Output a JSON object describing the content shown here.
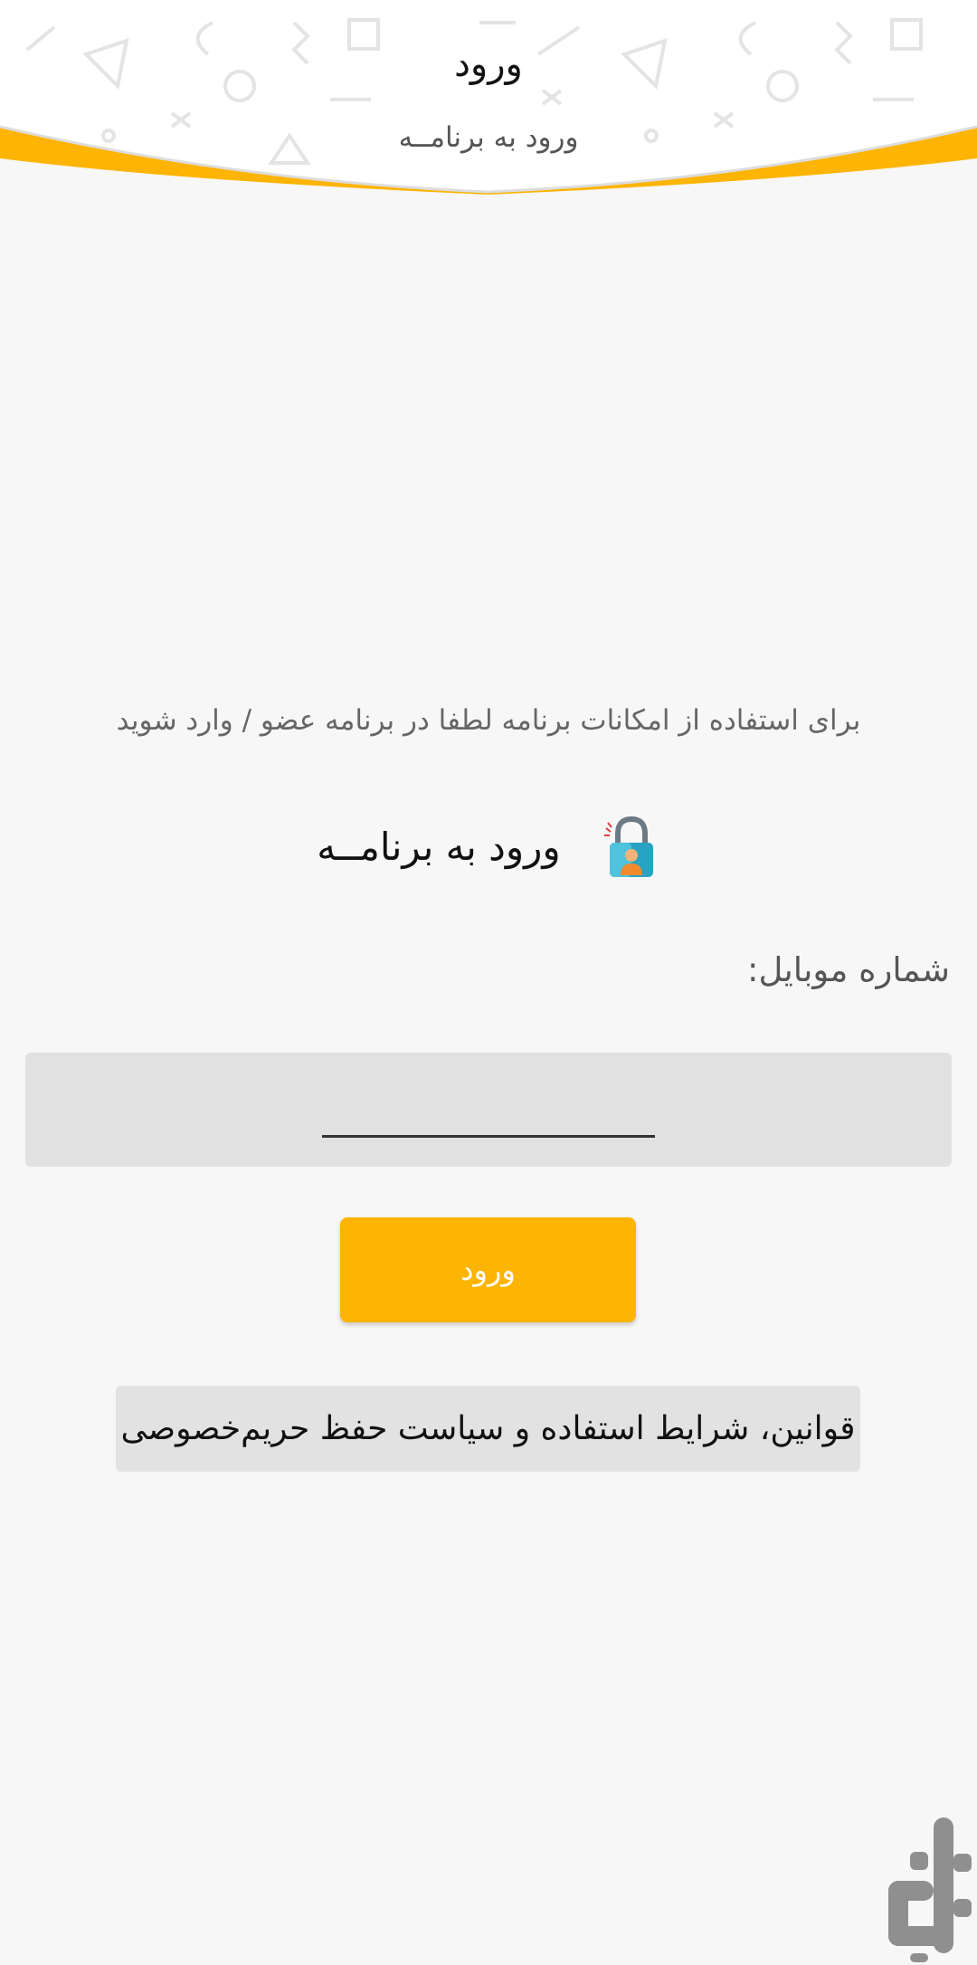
{
  "header": {
    "title": "ورود",
    "subtitle": "ورود به برنامــه"
  },
  "intro": {
    "text": "برای استفاده از امکانات برنامه لطفا در برنامه عضو / وارد شوید"
  },
  "login_heading": {
    "text": "ورود به برنامــه",
    "icon": "lock-user-icon"
  },
  "phone": {
    "label": "شماره موبایل:",
    "value": "",
    "placeholder": ""
  },
  "login_button": {
    "label": "ورود"
  },
  "terms_button": {
    "label": "قوانین، شرایط استفاده و سیاست حفظ حریم‌خصوصی"
  },
  "colors": {
    "accent": "#fdb402",
    "background": "#f7f7f7",
    "input_bg": "#e1e1e1"
  },
  "watermark": {
    "icon": "bazaar-logo-icon"
  }
}
